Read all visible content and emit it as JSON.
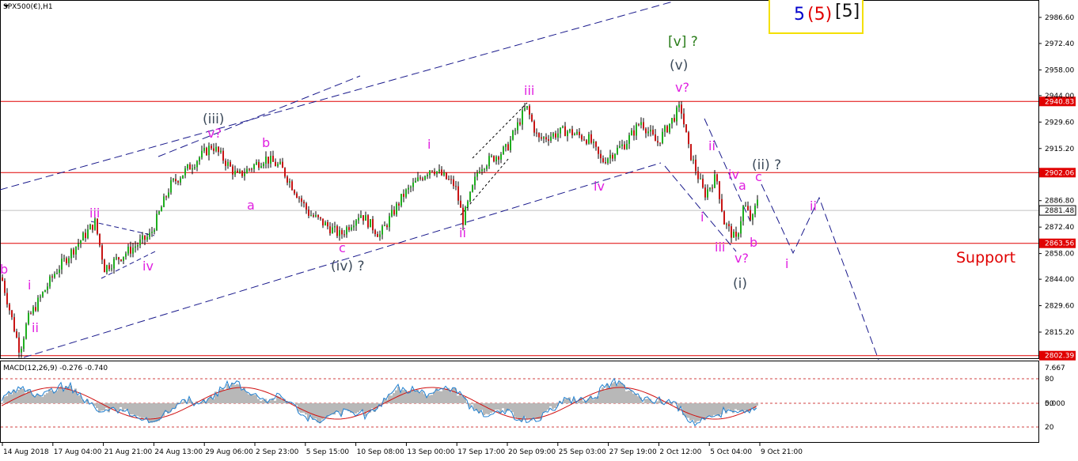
{
  "header": {
    "symbol_label": "SPX500(€),H1",
    "wave_box": {
      "n1": "5",
      "n2": "(5)",
      "n3": "[5]"
    }
  },
  "price_axis": {
    "ticks": [
      {
        "label": "2986.60",
        "value": 2986.6
      },
      {
        "label": "2972.40",
        "value": 2972.4
      },
      {
        "label": "2958.00",
        "value": 2958.0
      },
      {
        "label": "2944.00",
        "value": 2944.0
      },
      {
        "label": "2929.60",
        "value": 2929.6
      },
      {
        "label": "2915.20",
        "value": 2915.2
      },
      {
        "label": "2886.80",
        "value": 2886.8
      },
      {
        "label": "2872.40",
        "value": 2872.4
      },
      {
        "label": "2858.00",
        "value": 2858.0
      },
      {
        "label": "2844.00",
        "value": 2844.0
      },
      {
        "label": "2829.60",
        "value": 2829.6
      },
      {
        "label": "2815.20",
        "value": 2815.2
      }
    ],
    "levels": [
      {
        "label": "2940.83",
        "value": 2940.83,
        "color": "#e00000"
      },
      {
        "label": "2902.06",
        "value": 2902.06,
        "color": "#e00000"
      },
      {
        "label": "2881.48",
        "value": 2881.48,
        "color": "#ffffff"
      },
      {
        "label": "2863.56",
        "value": 2863.56,
        "color": "#e00000"
      },
      {
        "label": "2802.39",
        "value": 2802.39,
        "color": "#e00000"
      }
    ]
  },
  "time_axis": {
    "labels": [
      "14 Aug 2018",
      "17 Aug 04:00",
      "21 Aug 21:00",
      "24 Aug 13:00",
      "29 Aug 06:00",
      "2 Sep 23:00",
      "5 Sep 15:00",
      "10 Sep 08:00",
      "13 Sep 00:00",
      "17 Sep 17:00",
      "20 Sep 09:00",
      "25 Sep 03:00",
      "27 Sep 19:00",
      "2 Oct 12:00",
      "5 Oct 04:00",
      "9 Oct 21:00"
    ]
  },
  "macd": {
    "label": "MACD(12,26,9) -0.276 -0.740",
    "ticks": [
      {
        "label": "7.667",
        "value": 7.667
      },
      {
        "label": "80",
        "value": 80
      },
      {
        "label": "50",
        "value": 50
      },
      {
        "label": "0.000",
        "value": 0
      },
      {
        "label": "20",
        "value": 20
      }
    ]
  },
  "annotations": {
    "support": "Support",
    "waves_magenta": [
      "b",
      "i",
      "ii",
      "iii",
      "iv",
      "v?",
      "b",
      "a",
      "c",
      "iv",
      "ii",
      "iii",
      "i",
      "ii",
      "iv",
      "i",
      "ii",
      "iii",
      "iv",
      "v?",
      "ii",
      "a",
      "c",
      "b",
      "i",
      "ii"
    ],
    "waves_gray": [
      "(iii)",
      "(iv) ?",
      "(v)",
      "(i)",
      "(ii) ?"
    ],
    "wave_green": "[v] ?",
    "v_top": "v?"
  },
  "colors": {
    "level_line": "#e00000",
    "channel": "#1a1a8c",
    "magenta": "#e020e0",
    "bull": "#1fae1f",
    "bear": "#c81414",
    "macd_fill": "#b8b8b8",
    "signal": "#d01010",
    "osc": "#1e7fd0"
  }
}
